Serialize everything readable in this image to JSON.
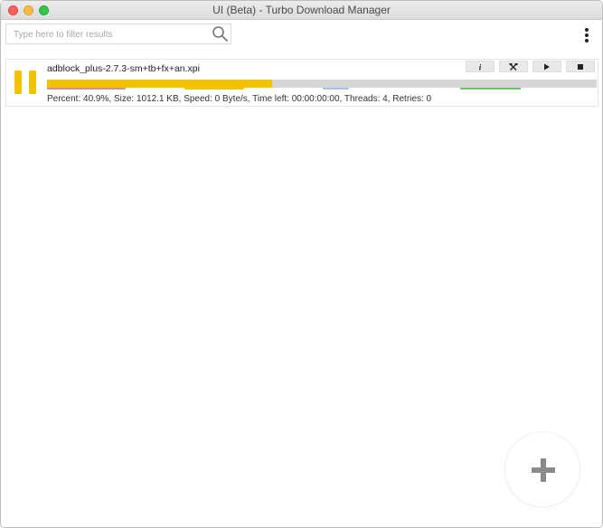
{
  "window": {
    "title": "UI (Beta) - Turbo Download Manager"
  },
  "search": {
    "placeholder": "Type here to filter results",
    "value": ""
  },
  "downloads": [
    {
      "filename": "adblock_plus-2.7.3-sm+tb+fx+an.xpi",
      "progress_percent": 40.9,
      "stats": "Percent: 40.9%, Size: 1012.1 KB, Speed: 0 Byte/s, Time left: 00:00:00:00, Threads: 4, Retries: 0",
      "state": "downloading",
      "actions": [
        "info-icon",
        "tools-icon",
        "play-icon",
        "stop-icon"
      ]
    }
  ],
  "colors": {
    "progress": "#f2c400",
    "pause_icon": "#f2c400",
    "thread_1": "#d78ab0",
    "thread_2": "#f2c400",
    "thread_3": "#a6c4ea",
    "thread_4": "#6cc46a"
  },
  "fab": {
    "icon": "plus-icon"
  }
}
